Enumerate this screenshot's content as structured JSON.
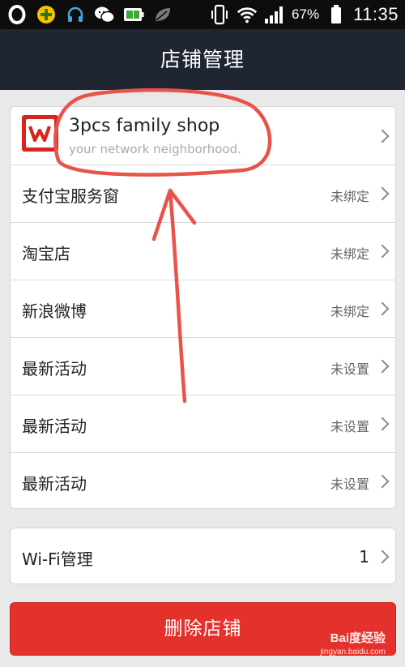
{
  "status_bar": {
    "battery_percent": "67%",
    "time": "11:35",
    "left_icons": [
      "opera-icon",
      "app-store-icon",
      "headset-icon",
      "wechat-icon",
      "battery-app-icon",
      "leaf-icon"
    ],
    "right_icons": [
      "vibrate-icon",
      "wifi-icon",
      "signal-icon",
      "battery-icon"
    ]
  },
  "header": {
    "title": "店铺管理"
  },
  "shop": {
    "name": "3pcs family shop",
    "tagline": "your network neighborhood.",
    "logo_icon": "wps-logo-icon"
  },
  "settings": {
    "rows": [
      {
        "label": "支付宝服务窗",
        "value": "未绑定"
      },
      {
        "label": "淘宝店",
        "value": "未绑定"
      },
      {
        "label": "新浪微博",
        "value": "未绑定"
      },
      {
        "label": "最新活动",
        "value": "未设置"
      },
      {
        "label": "最新活动",
        "value": "未设置"
      },
      {
        "label": "最新活动",
        "value": "未设置"
      }
    ]
  },
  "wifi": {
    "label": "Wi-Fi管理",
    "value": "1"
  },
  "actions": {
    "delete_label": "删除店铺"
  },
  "watermark": {
    "brand": "Bai度经验",
    "url": "jingyan.baidu.com"
  },
  "colors": {
    "status_bar": "#0d0d0d",
    "header": "#1f2632",
    "background": "#e9e9e9",
    "delete_button": "#e5312b",
    "annotation": "#e8534a"
  }
}
